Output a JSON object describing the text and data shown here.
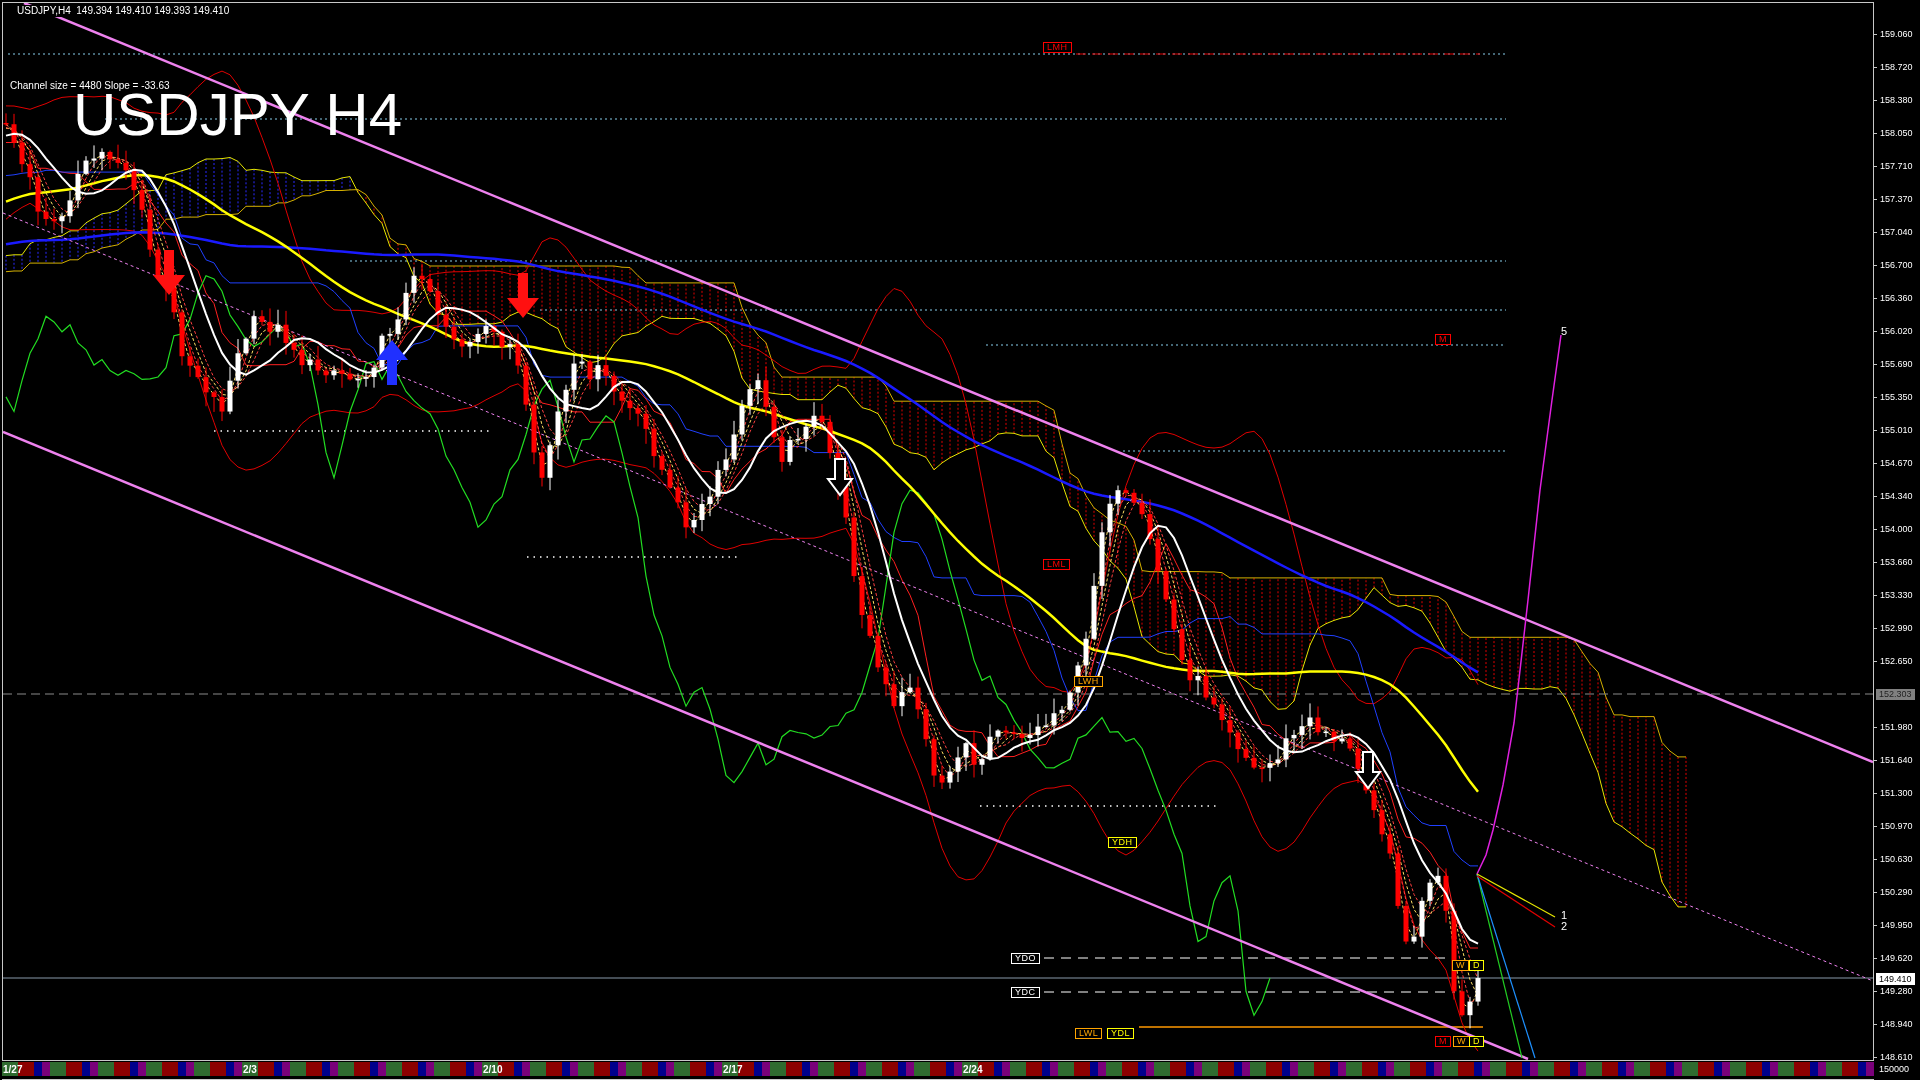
{
  "chart": {
    "symbol_info": "USDJPY,H4  149.394 149.410 149.393 149.410",
    "channel_info": "Channel size = 4480 Slope = -33.63",
    "title": "USDJPY H4",
    "level_labels": [
      {
        "text": "LMH",
        "color": "#ff0000"
      },
      {
        "text": "M",
        "color": "#ff0000"
      },
      {
        "text": "LML",
        "color": "#ff0000"
      },
      {
        "text": "LWH",
        "color": "#ffa500"
      },
      {
        "text": "YDH",
        "color": "#ffff00"
      },
      {
        "text": "YDO",
        "color": "#ffffff"
      },
      {
        "text": "W",
        "color": "#ffa500"
      },
      {
        "text": "D",
        "color": "#ffff00"
      },
      {
        "text": "YDC",
        "color": "#ffffff"
      },
      {
        "text": "LWL",
        "color": "#ffa500"
      },
      {
        "text": "YDL",
        "color": "#ffff00"
      },
      {
        "text": "M",
        "color": "#ff0000"
      },
      {
        "text": "W",
        "color": "#ffa500"
      },
      {
        "text": "D",
        "color": "#ffff00"
      }
    ],
    "projection_labels": [
      "5",
      "1",
      "2"
    ]
  },
  "price_axis": {
    "labels": [
      {
        "text": "159.060",
        "kind": "tick"
      },
      {
        "text": "158.720",
        "kind": "tick"
      },
      {
        "text": "158.380",
        "kind": "tick"
      },
      {
        "text": "158.050",
        "kind": "tick"
      },
      {
        "text": "157.710",
        "kind": "tick"
      },
      {
        "text": "157.370",
        "kind": "tick"
      },
      {
        "text": "157.040",
        "kind": "tick"
      },
      {
        "text": "156.700",
        "kind": "tick"
      },
      {
        "text": "156.360",
        "kind": "tick"
      },
      {
        "text": "156.020",
        "kind": "tick"
      },
      {
        "text": "155.690",
        "kind": "tick"
      },
      {
        "text": "155.350",
        "kind": "tick"
      },
      {
        "text": "155.010",
        "kind": "tick"
      },
      {
        "text": "154.670",
        "kind": "tick"
      },
      {
        "text": "154.340",
        "kind": "tick"
      },
      {
        "text": "154.000",
        "kind": "tick"
      },
      {
        "text": "153.660",
        "kind": "tick"
      },
      {
        "text": "153.330",
        "kind": "tick"
      },
      {
        "text": "152.990",
        "kind": "tick"
      },
      {
        "text": "152.650",
        "kind": "tick"
      },
      {
        "text": "152.303",
        "kind": "line_tag"
      },
      {
        "text": "151.980",
        "kind": "tick"
      },
      {
        "text": "151.640",
        "kind": "tick"
      },
      {
        "text": "151.300",
        "kind": "tick"
      },
      {
        "text": "150.970",
        "kind": "tick"
      },
      {
        "text": "150.630",
        "kind": "tick"
      },
      {
        "text": "150.290",
        "kind": "tick"
      },
      {
        "text": "149.950",
        "kind": "tick"
      },
      {
        "text": "149.620",
        "kind": "tick"
      },
      {
        "text": "149.410",
        "kind": "bid_tag"
      },
      {
        "text": "149.280",
        "kind": "tick"
      },
      {
        "text": "148.940",
        "kind": "tick"
      },
      {
        "text": "148.610",
        "kind": "tick"
      }
    ],
    "footer": "150000"
  },
  "date_axis": [
    "1/27",
    "2/3",
    "2/10",
    "2/17",
    "2/24"
  ]
}
